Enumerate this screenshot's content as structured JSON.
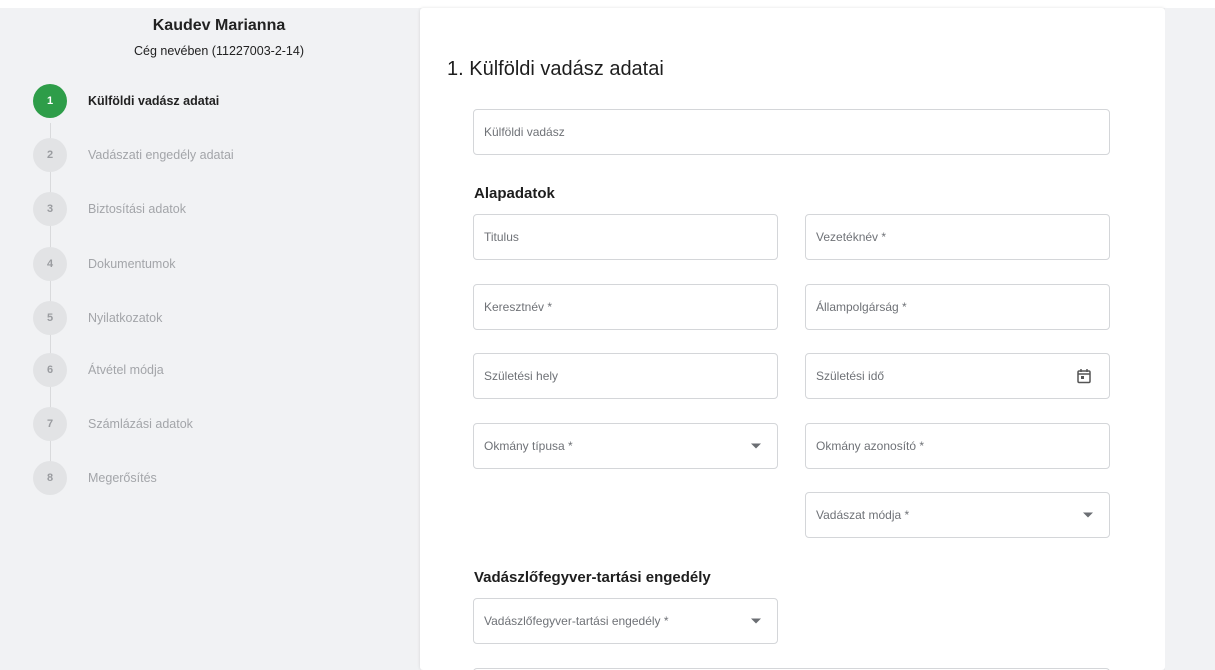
{
  "user": {
    "name": "Kaudev Marianna",
    "subtitle": "Cég nevében (11227003-2-14)"
  },
  "steps": [
    {
      "number": "1",
      "label": "Külföldi vadász adatai",
      "active": true
    },
    {
      "number": "2",
      "label": "Vadászati engedély adatai",
      "active": false
    },
    {
      "number": "3",
      "label": "Biztosítási adatok",
      "active": false
    },
    {
      "number": "4",
      "label": "Dokumentumok",
      "active": false
    },
    {
      "number": "5",
      "label": "Nyilatkozatok",
      "active": false
    },
    {
      "number": "6",
      "label": "Átvétel módja",
      "active": false
    },
    {
      "number": "7",
      "label": "Számlázási adatok",
      "active": false
    },
    {
      "number": "8",
      "label": "Megerősítés",
      "active": false
    }
  ],
  "form": {
    "page_title": "1. Külföldi vadász adatai",
    "foreign_hunter_placeholder": "Külföldi vadász",
    "basic_section_title": "Alapadatok",
    "titulus": "Titulus",
    "last_name": "Vezetéknév *",
    "first_name": "Keresztnév *",
    "citizenship": "Állampolgárság *",
    "birth_place": "Születési hely",
    "birth_date": "Születési idő",
    "doc_type": "Okmány típusa *",
    "doc_id": "Okmány azonosító *",
    "hunting_mode": "Vadászat módja *",
    "weapon_section_title": "Vadászlőfegyver-tartási engedély",
    "weapon_license": "Vadászlőfegyver-tartási engedély *"
  },
  "colors": {
    "active_step": "#2e9d49",
    "inactive_step": "#e2e3e5",
    "background": "#f1f2f4"
  },
  "icons": {
    "calendar": "calendar-icon",
    "dropdown": "chevron-down-icon"
  }
}
